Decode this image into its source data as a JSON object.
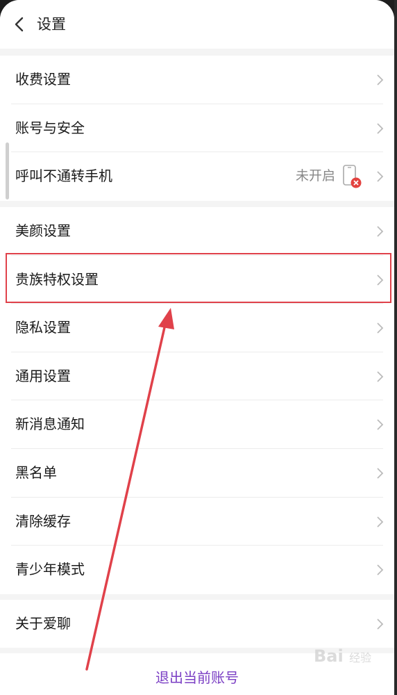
{
  "header": {
    "title": "设置"
  },
  "groups": {
    "g1": [
      {
        "label": "收费设置"
      },
      {
        "label": "账号与安全"
      },
      {
        "label": "呼叫不通转手机",
        "value": "未开启"
      }
    ],
    "g2": [
      {
        "label": "美颜设置"
      },
      {
        "label": "贵族特权设置"
      },
      {
        "label": "隐私设置"
      },
      {
        "label": "通用设置"
      },
      {
        "label": "新消息通知"
      },
      {
        "label": "黑名单"
      },
      {
        "label": "清除缓存"
      },
      {
        "label": "青少年模式"
      }
    ],
    "g3": [
      {
        "label": "关于爱聊"
      }
    ]
  },
  "logout": {
    "label": "退出当前账号"
  },
  "colors": {
    "accent_purple": "#7b3fc4",
    "annotation_red": "#e0414a"
  },
  "watermark": {
    "text": "Bai",
    "suffix": "经验"
  }
}
